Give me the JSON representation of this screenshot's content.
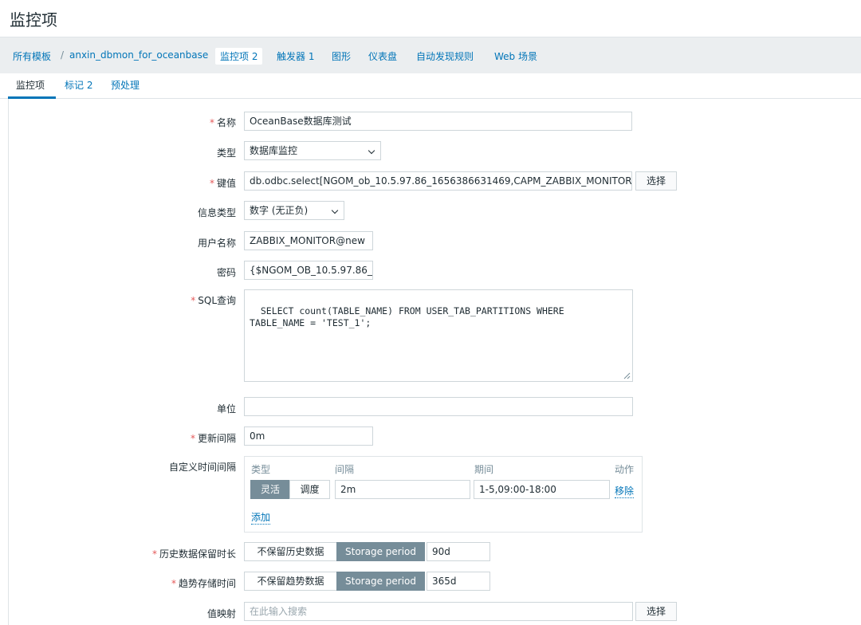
{
  "page": {
    "title": "监控项"
  },
  "breadcrumb": {
    "all_templates": "所有模板",
    "separator": "/",
    "template": "anxin_dbmon_for_oceanbase",
    "items": "监控项 2",
    "triggers": "触发器 1",
    "graphs": "图形",
    "dashboards": "仪表盘",
    "discovery": "自动发现规则",
    "web": "Web 场景"
  },
  "tabs": {
    "item": "监控项",
    "tags": "标记 2",
    "preprocessing": "预处理"
  },
  "form": {
    "required_mark": "*",
    "name": {
      "label": "名称",
      "value": "OceanBase数据库测试"
    },
    "type": {
      "label": "类型",
      "value": "数据库监控"
    },
    "key": {
      "label": "键值",
      "value": "db.odbc.select[NGOM_ob_10.5.97.86_1656386631469,CAPM_ZABBIX_MONITOR",
      "select_button": "选择"
    },
    "info_type": {
      "label": "信息类型",
      "value": "数字 (无正负)"
    },
    "username": {
      "label": "用户名称",
      "value": "ZABBIX_MONITOR@new"
    },
    "password": {
      "label": "密码",
      "value": "{$NGOM_OB_10.5.97.86_"
    },
    "sql": {
      "label": "SQL查询",
      "value": "SELECT count(TABLE_NAME) FROM USER_TAB_PARTITIONS WHERE\nTABLE_NAME = 'TEST_1';"
    },
    "units": {
      "label": "单位",
      "value": ""
    },
    "update_interval": {
      "label": "更新间隔",
      "value": "0m"
    },
    "custom_intervals": {
      "label": "自定义时间间隔",
      "col_type": "类型",
      "col_interval": "间隔",
      "col_period": "期间",
      "col_action": "动作",
      "flexible": "灵活",
      "scheduling": "调度",
      "interval_value": "2m",
      "period_value": "1-5,09:00-18:00",
      "remove": "移除",
      "add": "添加"
    },
    "history": {
      "label": "历史数据保留时长",
      "do_not_keep": "不保留历史数据",
      "storage_period": "Storage period",
      "value": "90d"
    },
    "trends": {
      "label": "趋势存储时间",
      "do_not_keep": "不保留趋势数据",
      "storage_period": "Storage period",
      "value": "365d"
    },
    "value_map": {
      "label": "值映射",
      "placeholder": "在此输入搜索",
      "select_button": "选择"
    }
  },
  "colors": {
    "link": "#0275b8",
    "required": "#e45959",
    "segment_active": "#768d99",
    "tab_underline": "#0275b8"
  }
}
